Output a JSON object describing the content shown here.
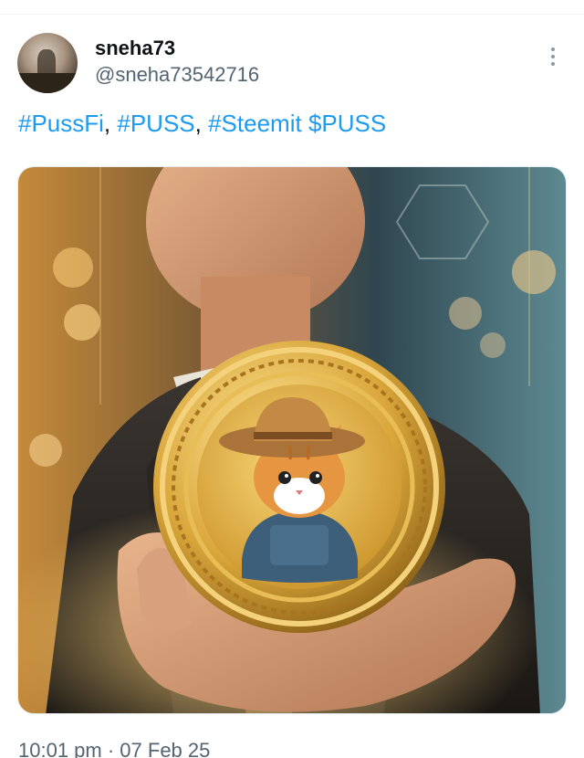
{
  "tweet": {
    "display_name": "sneha73",
    "handle": "@sneha73542716",
    "hashtags": [
      "#PussFi",
      "#PUSS",
      "#Steemit"
    ],
    "separator": ", ",
    "cashtag": "$PUSS",
    "time": "10:01 pm",
    "dot": " · ",
    "date": "07 Feb 25"
  },
  "icons": {
    "more": "more-vertical-icon",
    "avatar": "avatar"
  },
  "colors": {
    "link": "#1d9bf0",
    "text": "#0f1419",
    "secondary": "#536471"
  }
}
